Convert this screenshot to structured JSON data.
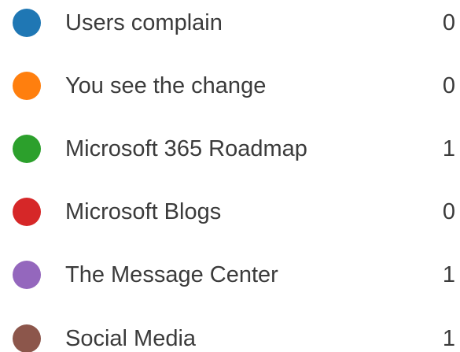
{
  "legend": {
    "items": [
      {
        "label": "Users complain",
        "count": "0",
        "color": "#1f77b4"
      },
      {
        "label": "You see the change",
        "count": "0",
        "color": "#ff7f0e"
      },
      {
        "label": "Microsoft 365 Roadmap",
        "count": "1",
        "color": "#2ca02c"
      },
      {
        "label": "Microsoft Blogs",
        "count": "0",
        "color": "#d62728"
      },
      {
        "label": "The Message Center",
        "count": "1",
        "color": "#9467bd"
      },
      {
        "label": "Social Media",
        "count": "1",
        "color": "#8c564b"
      }
    ]
  }
}
